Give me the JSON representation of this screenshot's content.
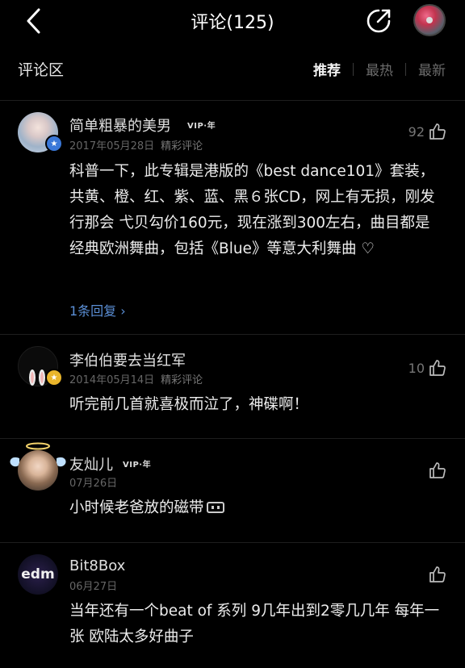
{
  "header": {
    "title": "评论(125)"
  },
  "section": {
    "title": "评论区",
    "tabs": [
      "推荐",
      "最热",
      "最新"
    ]
  },
  "comments": [
    {
      "username": "简单粗暴的美男",
      "vip": "VIP·年",
      "date": "2017年05月28日",
      "tag": "精彩评论",
      "likes": "92",
      "text": "科普一下，此专辑是港版的《best dance101》套装，共黄、橙、红、紫、蓝、黑６张CD，网上有无损，刚发行那会 弋贝勾价160元，现在涨到300左右，曲目都是经典欧洲舞曲，包括《Blue》等意大利舞曲 ♡",
      "reply": "1条回复 ›"
    },
    {
      "username": "李伯伯要去当红军",
      "date": "2014年05月14日",
      "tag": "精彩评论",
      "likes": "10",
      "text": "听完前几首就喜极而泣了，神碟啊！"
    },
    {
      "username": "友灿儿",
      "vip": "VIP·年",
      "date": "07月26日",
      "text": "小时候老爸放的磁带"
    },
    {
      "username": "Bit8Box",
      "date": "06月27日",
      "text": "当年还有一个beat of 系列 9几年出到2零几几年 每年一张 欧陆太多好曲子",
      "avatar_text": "edm"
    }
  ],
  "colors": {
    "link": "#5b8fd6",
    "background": "#000000"
  }
}
